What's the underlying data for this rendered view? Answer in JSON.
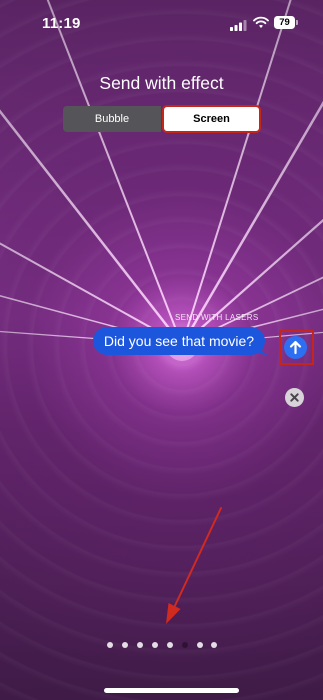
{
  "status_bar": {
    "time": "11:19",
    "battery_level": "79",
    "icons": [
      "signal-icon",
      "wifi-icon",
      "battery-icon"
    ]
  },
  "header": {
    "title": "Send with effect"
  },
  "segmented_control": {
    "options": [
      "Bubble",
      "Screen"
    ],
    "selected": "Screen"
  },
  "message": {
    "effect_label": "SEND WITH LASERS",
    "text": "Did you see that movie?"
  },
  "controls": {
    "send_icon": "arrow-up-icon",
    "close_icon": "close-icon"
  },
  "pagination": {
    "total": 8,
    "active_index": 5
  },
  "colors": {
    "bubble_blue": "#1b56dd",
    "send_blue": "#2d6ff2",
    "highlight_red": "#c4261c",
    "background_purple": "#5d2466",
    "annotation_arrow": "#d12a20"
  }
}
